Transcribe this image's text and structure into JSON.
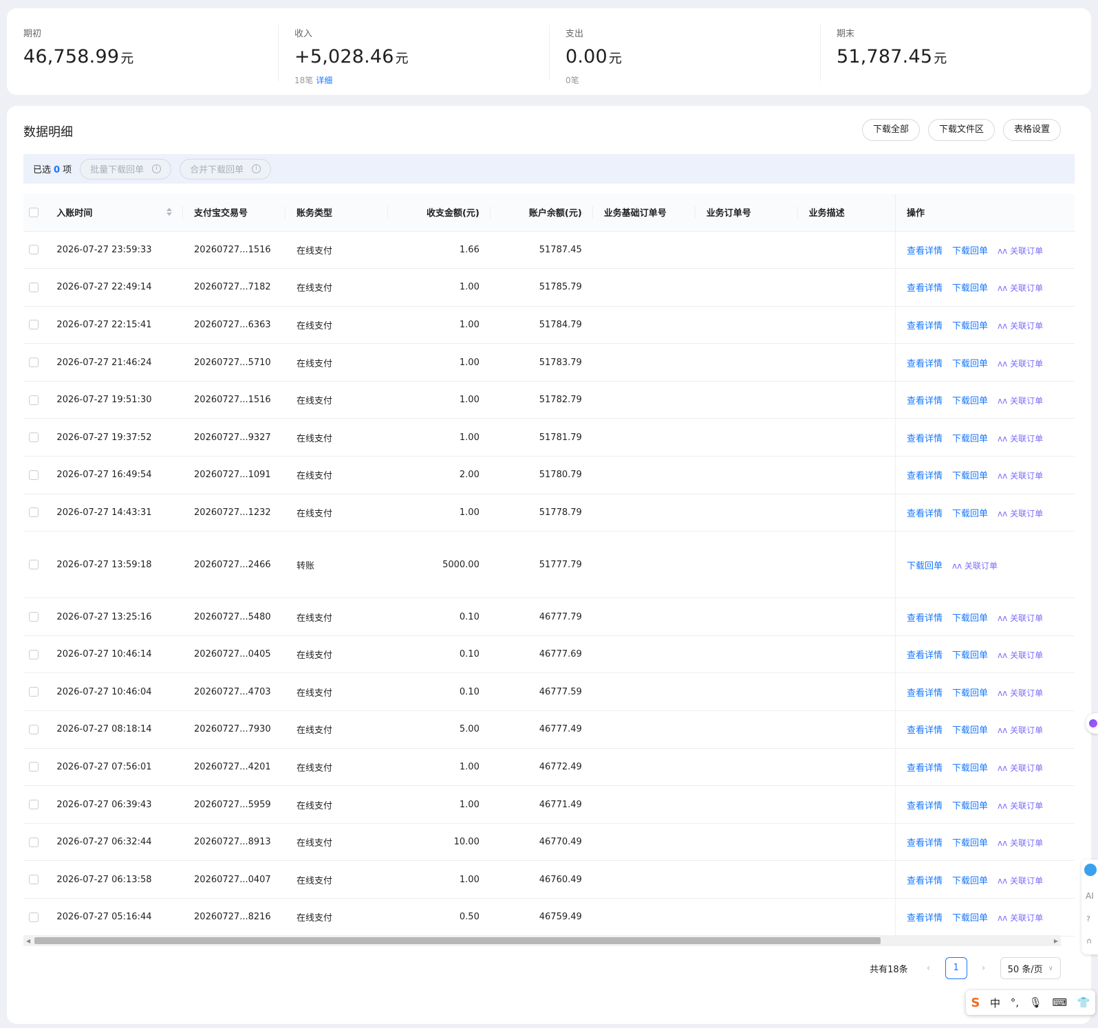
{
  "summary": {
    "opening": {
      "label": "期初",
      "value": "46,758.99",
      "unit": "元"
    },
    "income": {
      "label": "收入",
      "value": "+5,028.46",
      "unit": "元",
      "count": "18笔",
      "detail_link": "详细"
    },
    "expense": {
      "label": "支出",
      "value": "0.00",
      "unit": "元",
      "count": "0笔"
    },
    "closing": {
      "label": "期末",
      "value": "51,787.45",
      "unit": "元"
    }
  },
  "main": {
    "title": "数据明细",
    "buttons": {
      "download_all": "下载全部",
      "download_area": "下载文件区",
      "table_settings": "表格设置"
    }
  },
  "selection": {
    "prefix": "已选",
    "count": "0",
    "suffix": "项",
    "batch_download": "批量下载回单",
    "merge_download": "合并下载回单"
  },
  "table": {
    "headers": {
      "time": "入账时间",
      "trade_no": "支付宝交易号",
      "type": "账务类型",
      "amount": "收支金额(元)",
      "balance": "账户余额(元)",
      "base_order": "业务基础订单号",
      "order": "业务订单号",
      "desc": "业务描述",
      "ops": "操作"
    },
    "op_labels": {
      "detail": "查看详情",
      "download": "下载回单",
      "relate": "关联订单"
    },
    "rows": [
      {
        "time": "2026-07-27 23:59:33",
        "trade_no": "20260727...1516",
        "type": "在线支付",
        "amount": "1.66",
        "balance": "51787.45"
      },
      {
        "time": "2026-07-27 22:49:14",
        "trade_no": "20260727...7182",
        "type": "在线支付",
        "amount": "1.00",
        "balance": "51785.79"
      },
      {
        "time": "2026-07-27 22:15:41",
        "trade_no": "20260727...6363",
        "type": "在线支付",
        "amount": "1.00",
        "balance": "51784.79"
      },
      {
        "time": "2026-07-27 21:46:24",
        "trade_no": "20260727...5710",
        "type": "在线支付",
        "amount": "1.00",
        "balance": "51783.79"
      },
      {
        "time": "2026-07-27 19:51:30",
        "trade_no": "20260727...1516",
        "type": "在线支付",
        "amount": "1.00",
        "balance": "51782.79"
      },
      {
        "time": "2026-07-27 19:37:52",
        "trade_no": "20260727...9327",
        "type": "在线支付",
        "amount": "1.00",
        "balance": "51781.79"
      },
      {
        "time": "2026-07-27 16:49:54",
        "trade_no": "20260727...1091",
        "type": "在线支付",
        "amount": "2.00",
        "balance": "51780.79"
      },
      {
        "time": "2026-07-27 14:43:31",
        "trade_no": "20260727...1232",
        "type": "在线支付",
        "amount": "1.00",
        "balance": "51778.79"
      },
      {
        "time": "2026-07-27 13:59:18",
        "trade_no": "20260727...2466",
        "type": "转账",
        "amount": "5000.00",
        "balance": "51777.79"
      },
      {
        "time": "2026-07-27 13:25:16",
        "trade_no": "20260727...5480",
        "type": "在线支付",
        "amount": "0.10",
        "balance": "46777.79"
      },
      {
        "time": "2026-07-27 10:46:14",
        "trade_no": "20260727...0405",
        "type": "在线支付",
        "amount": "0.10",
        "balance": "46777.69"
      },
      {
        "time": "2026-07-27 10:46:04",
        "trade_no": "20260727...4703",
        "type": "在线支付",
        "amount": "0.10",
        "balance": "46777.59"
      },
      {
        "time": "2026-07-27 08:18:14",
        "trade_no": "20260727...7930",
        "type": "在线支付",
        "amount": "5.00",
        "balance": "46777.49"
      },
      {
        "time": "2026-07-27 07:56:01",
        "trade_no": "20260727...4201",
        "type": "在线支付",
        "amount": "1.00",
        "balance": "46772.49"
      },
      {
        "time": "2026-07-27 06:39:43",
        "trade_no": "20260727...5959",
        "type": "在线支付",
        "amount": "1.00",
        "balance": "46771.49"
      },
      {
        "time": "2026-07-27 06:32:44",
        "trade_no": "20260727...8913",
        "type": "在线支付",
        "amount": "10.00",
        "balance": "46770.49"
      },
      {
        "time": "2026-07-27 06:13:58",
        "trade_no": "20260727...0407",
        "type": "在线支付",
        "amount": "1.00",
        "balance": "46760.49"
      },
      {
        "time": "2026-07-27 05:16:44",
        "trade_no": "20260727...8216",
        "type": "在线支付",
        "amount": "0.50",
        "balance": "46759.49"
      }
    ]
  },
  "pagination": {
    "total": "共有18条",
    "current": "1",
    "page_size": "50 条/页"
  },
  "ime": {
    "mode": "中"
  },
  "side": {
    "ai": "AI"
  }
}
